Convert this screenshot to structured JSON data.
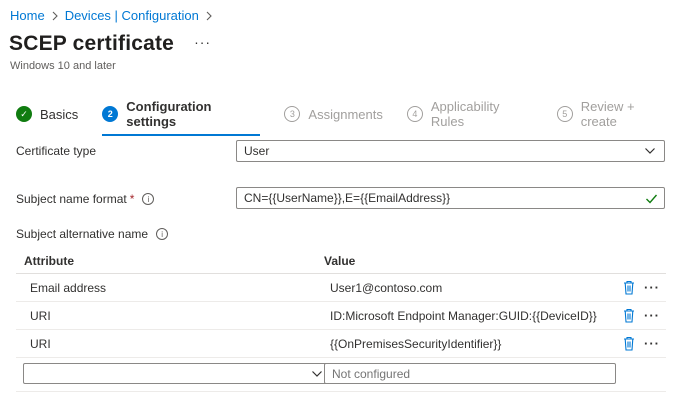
{
  "breadcrumb": {
    "items": [
      "Home",
      "Devices | Configuration"
    ]
  },
  "page": {
    "title": "SCEP certificate",
    "more_label": "···",
    "subtitle": "Windows 10 and later"
  },
  "steps": [
    {
      "num": "✓",
      "label": "Basics",
      "state": "done"
    },
    {
      "num": "2",
      "label": "Configuration settings",
      "state": "active"
    },
    {
      "num": "3",
      "label": "Assignments",
      "state": "pending"
    },
    {
      "num": "4",
      "label": "Applicability Rules",
      "state": "pending"
    },
    {
      "num": "5",
      "label": "Review + create",
      "state": "pending"
    }
  ],
  "form": {
    "certificate_type_label": "Certificate type",
    "certificate_type_value": "User",
    "subject_name_format_label": "Subject name format",
    "required_marker": "*",
    "subject_name_format_value": "CN={{UserName}},E={{EmailAddress}}",
    "subject_alt_name_label": "Subject alternative name",
    "info_glyph": "i"
  },
  "san_table": {
    "headers": {
      "attribute": "Attribute",
      "value": "Value"
    },
    "rows": [
      {
        "attribute": "Email address",
        "value": "User1@contoso.com"
      },
      {
        "attribute": "URI",
        "value": "ID:Microsoft Endpoint Manager:GUID:{{DeviceID}}"
      },
      {
        "attribute": "URI",
        "value": "{{OnPremisesSecurityIdentifier}}"
      }
    ],
    "new_row": {
      "attribute_value": "",
      "value_placeholder": "Not configured"
    },
    "row_more_label": "···"
  },
  "colors": {
    "accent": "#0078d4",
    "success": "#107c10",
    "required": "#a4262c"
  },
  "icons": {
    "breadcrumb_separator": "chevron-right-icon",
    "dropdown": "chevron-down-icon",
    "valid": "checkmark-icon",
    "delete": "trash-icon",
    "more": "more-horizontal-icon",
    "info": "info-icon"
  }
}
